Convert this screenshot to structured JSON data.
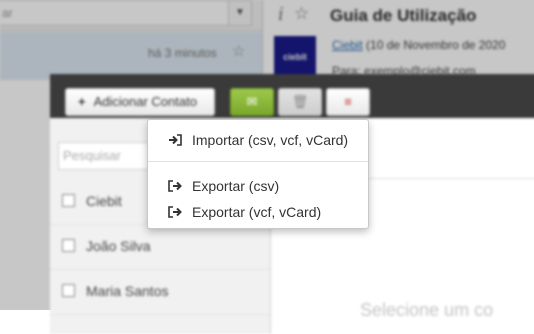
{
  "background": {
    "search_placeholder": "ar",
    "message_time": "há 3 minutos",
    "mail_title": "Guia de Utilização",
    "sender_logo": "ciebit",
    "sender_name": "Ciebit",
    "sender_date": "(10 de Novembro de 2020",
    "to_line": "Para: exemplo@ciebit.com"
  },
  "modal": {
    "add_contact_label": "Adicionar Contato",
    "search_placeholder": "Pesquisar",
    "contacts": [
      {
        "name": "Ciebit"
      },
      {
        "name": "João Silva"
      },
      {
        "name": "Maria Santos"
      }
    ],
    "empty_state": "Selecione um co"
  },
  "dropdown": {
    "import_label": "Importar (csv, vcf, vCard)",
    "export_csv_label": "Exportar (csv)",
    "export_vcf_label": "Exportar (vcf, vCard)",
    "icons": [
      "sign-in-icon",
      "sign-out-icon",
      "sign-out-icon"
    ]
  },
  "colors": {
    "header_bg": "#3a3a3a",
    "mail_button": "#8ab83a",
    "menu_icon": "#c0392b",
    "link": "#2a6db0"
  }
}
